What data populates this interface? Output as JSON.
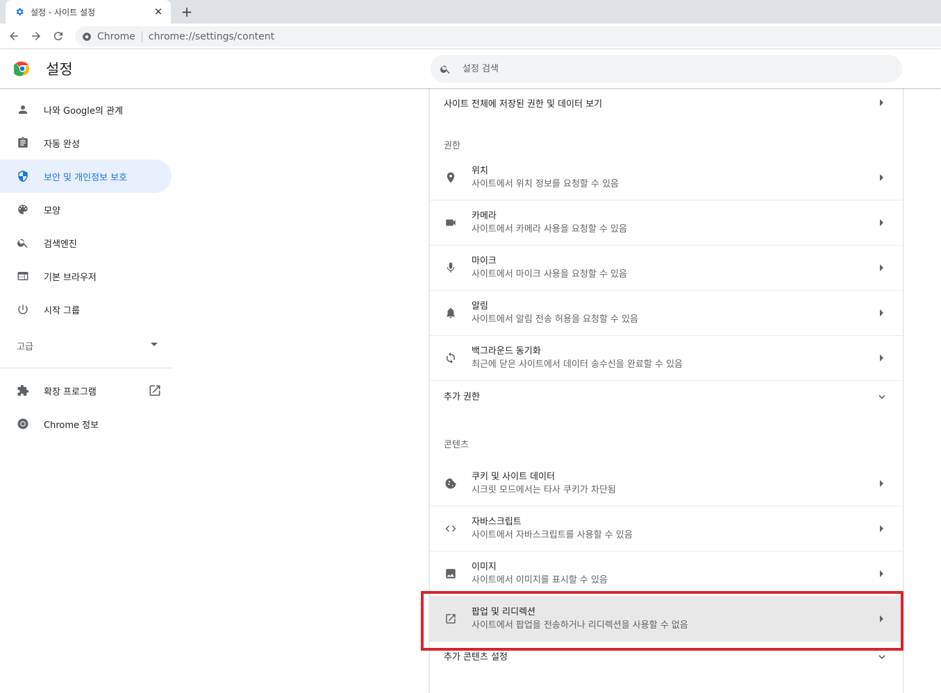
{
  "browser": {
    "tab_title": "설정 - 사이트 설정",
    "site_chip": "Chrome",
    "url_scheme": "chrome://",
    "url_path": "settings/content"
  },
  "header": {
    "title": "설정",
    "search_placeholder": "설정 검색"
  },
  "sidebar": {
    "items": [
      {
        "label": "나와 Google의 관계",
        "icon": "person-icon"
      },
      {
        "label": "자동 완성",
        "icon": "clipboard-icon"
      },
      {
        "label": "보안 및 개인정보 보호",
        "icon": "shield-icon",
        "active": true
      },
      {
        "label": "모양",
        "icon": "palette-icon"
      },
      {
        "label": "검색엔진",
        "icon": "search-icon"
      },
      {
        "label": "기본 브라우저",
        "icon": "browser-icon"
      },
      {
        "label": "시작 그룹",
        "icon": "power-icon"
      }
    ],
    "advanced_label": "고급",
    "extensions_label": "확장 프로그램",
    "about_label": "Chrome 정보"
  },
  "main": {
    "all_sites_label": "사이트 전체에 저장된 권한 및 데이터 보기",
    "permissions_heading": "권한",
    "permissions": [
      {
        "title": "위치",
        "desc": "사이트에서 위치 정보를 요청할 수 있음",
        "icon": "location-icon"
      },
      {
        "title": "카메라",
        "desc": "사이트에서 카메라 사용을 요청할 수 있음",
        "icon": "camera-icon"
      },
      {
        "title": "마이크",
        "desc": "사이트에서 마이크 사용을 요청할 수 있음",
        "icon": "microphone-icon"
      },
      {
        "title": "알림",
        "desc": "사이트에서 알림 전송 허용을 요청할 수 있음",
        "icon": "bell-icon"
      },
      {
        "title": "백그라운드 동기화",
        "desc": "최근에 닫은 사이트에서 데이터 송수신을 완료할 수 있음",
        "icon": "sync-icon"
      }
    ],
    "additional_permissions_label": "추가 권한",
    "content_heading": "콘텐츠",
    "content": [
      {
        "title": "쿠키 및 사이트 데이터",
        "desc": "시크릿 모드에서는 타사 쿠키가 차단됨",
        "icon": "cookie-icon"
      },
      {
        "title": "자바스크립트",
        "desc": "사이트에서 자바스크립트를 사용할 수 있음",
        "icon": "code-icon"
      },
      {
        "title": "이미지",
        "desc": "사이트에서 이미지를 표시할 수 있음",
        "icon": "image-icon"
      },
      {
        "title": "팝업 및 리디렉션",
        "desc": "사이트에서 팝업을 전송하거나 리디렉션을 사용할 수 없음",
        "icon": "open-in-new-icon",
        "highlighted": true
      }
    ],
    "additional_content_label": "추가 콘텐츠 설정"
  },
  "colors": {
    "accent": "#1a73e8",
    "active_nav_bg": "#e8f0fe",
    "highlight_border": "#d9242b",
    "highlight_row_bg": "#e8e8e8"
  }
}
